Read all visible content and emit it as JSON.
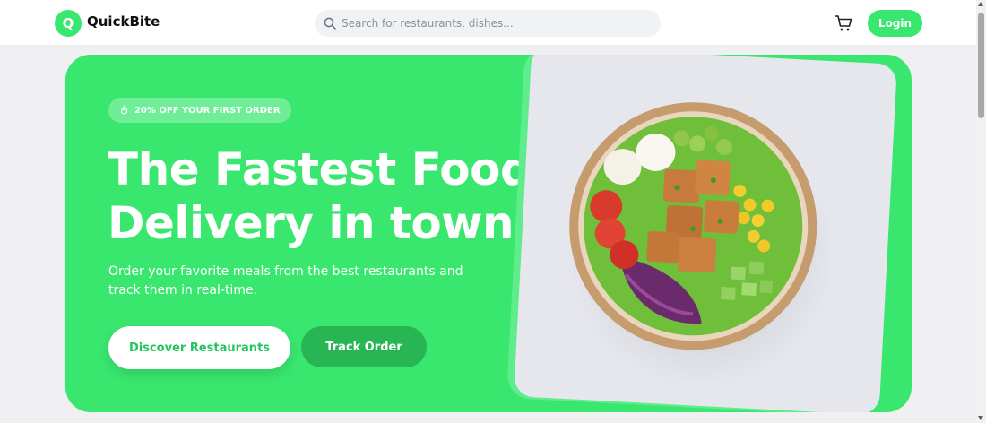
{
  "header": {
    "logo_letter": "Q",
    "brand": "QuickBite",
    "search_placeholder": "Search for restaurants, dishes...",
    "cart_icon": "cart-icon",
    "login_label": "Login"
  },
  "hero": {
    "badge_icon": "flame-icon",
    "badge_text": "20% OFF YOUR FIRST ORDER",
    "headline_line1": "The Fastest Food",
    "headline_line2": "Delivery in town.",
    "subtitle": "Order your favorite meals from the best restaurants and track them in real-time.",
    "primary_cta": "Discover Restaurants",
    "secondary_cta": "Track Order",
    "image_subject": "salad-bowl"
  },
  "colors": {
    "brand_green": "#39e76f",
    "dark_green": "#28b554",
    "text_dark": "#111111",
    "page_bg": "#f0f0f3"
  }
}
